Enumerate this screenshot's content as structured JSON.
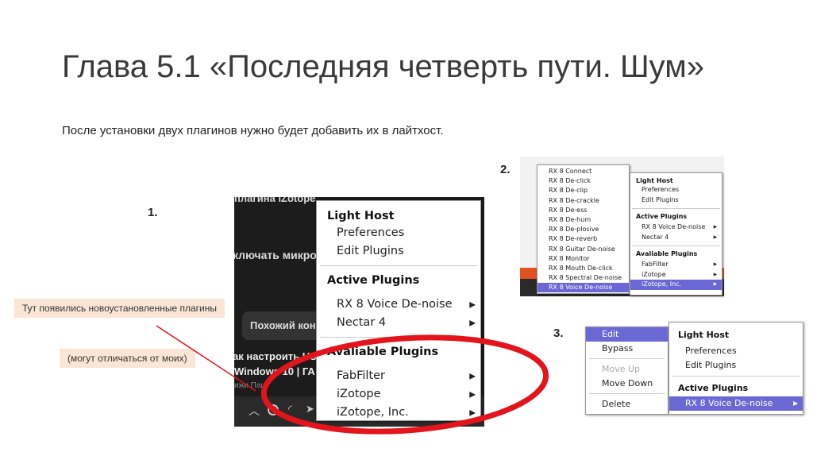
{
  "slide": {
    "title": "Глава 5.1 «Последняя четверть пути. Шум»",
    "subtitle": "После установки двух плагинов нужно будет добавить их в лайтхост.",
    "step1": "1.",
    "step2": "2.",
    "step3": "3.",
    "note1": "Тут появились новоустановленные плагины",
    "note2": "(могут отличаться от моих)"
  },
  "background_text": [
    "плагина iZotope",
    "ключать микро",
    "Похожий кон",
    "ак настроить US",
    "Windows 10 | ГА",
    "ижи Паш"
  ],
  "menu": {
    "header": "Light Host",
    "preferences": "Preferences",
    "edit_plugins": "Edit Plugins",
    "active_header": "Active Plugins",
    "active": [
      "RX 8 Voice De-noise",
      "Nectar 4"
    ],
    "available_header": "Avaliable Plugins",
    "available": [
      "FabFilter",
      "iZotope",
      "iZotope, Inc."
    ],
    "arrow": "▶"
  },
  "submenu_izotope": [
    "RX 8 Connect",
    "RX 8 De-click",
    "RX 8 De-clip",
    "RX 8 De-crackle",
    "RX 8 De-ess",
    "RX 8 De-hum",
    "RX 8 De-plosive",
    "RX 8 De-reverb",
    "RX 8 Guitar De-noise",
    "RX 8 Monitor",
    "RX 8 Mouth De-click",
    "RX 8 Spectral De-noise",
    "RX 8 Voice De-noise"
  ],
  "plugin_menu": {
    "edit": "Edit",
    "bypass": "Bypass",
    "move_up": "Move Up",
    "move_down": "Move Down",
    "delete": "Delete"
  },
  "colors": {
    "highlight": "#6a68d4",
    "annotation_red": "#e3141b",
    "note_bg": "#fbe5d6"
  }
}
